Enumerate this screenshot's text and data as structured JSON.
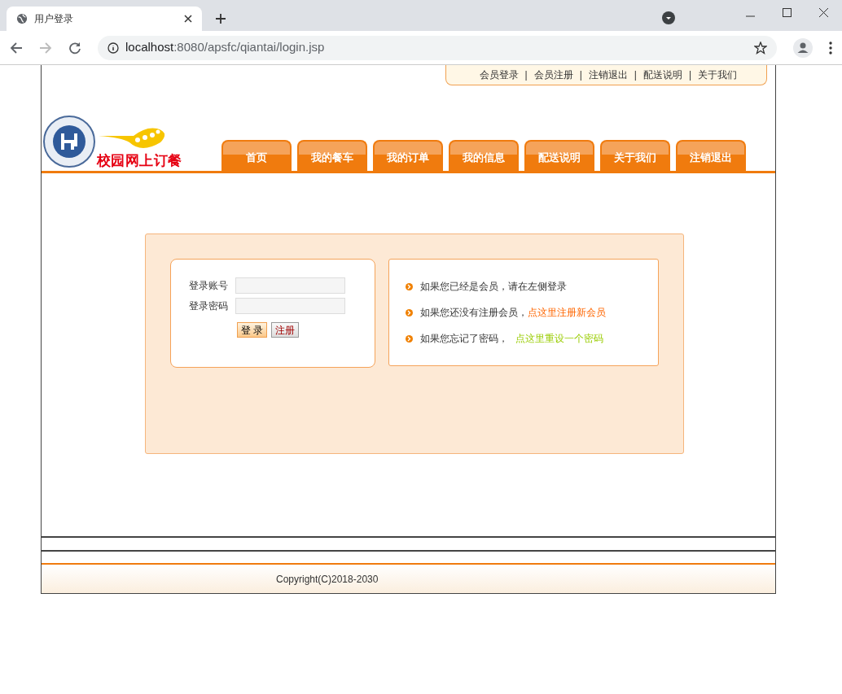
{
  "browser": {
    "tab_title": "用户登录",
    "url_host": "localhost",
    "url_path": ":8080/apsfc/qiantai/login.jsp"
  },
  "top_links": {
    "separator": "|",
    "items": [
      "会员登录",
      "会员注册",
      "注销退出",
      "配送说明",
      "关于我们"
    ]
  },
  "logo_text": "校园网上订餐",
  "nav": [
    "首页",
    "我的餐车",
    "我的订单",
    "我的信息",
    "配送说明",
    "关于我们",
    "注销退出"
  ],
  "login": {
    "fields": [
      {
        "label": "登录账号"
      },
      {
        "label": "登录密码"
      }
    ],
    "buttons": [
      {
        "label": "登 录",
        "kind": "primary"
      },
      {
        "label": "注册",
        "kind": "secondary"
      }
    ]
  },
  "info": [
    {
      "text": "如果您已经是会员，请在左侧登录"
    },
    {
      "text": "如果您还没有注册会员，",
      "link": "点这里注册新会员",
      "kind": "register"
    },
    {
      "text": "如果您忘记了密码，",
      "link": "点这里重设一个密码",
      "kind": "reset"
    }
  ],
  "footer": {
    "copyright": "Copyright(C)2018-2030"
  }
}
